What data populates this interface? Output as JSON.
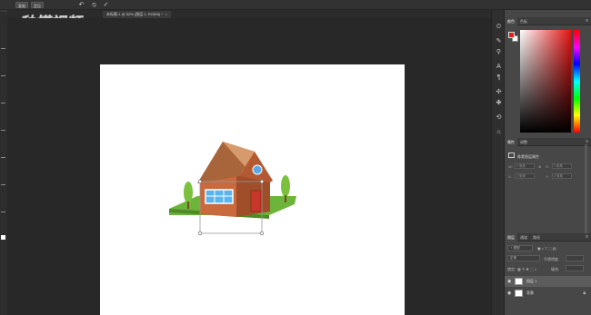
{
  "options_bar": {
    "buttons": [
      "复制",
      "定位"
    ],
    "flip_label": "↶",
    "cancel_label": "⦸",
    "commit_label": "✓"
  },
  "watermark": {
    "text": "秒懂视频"
  },
  "document": {
    "tab_title": "未标题-1 @ 50% (图层 1, RGB/8) *",
    "close": "×"
  },
  "panels": {
    "color": {
      "tabs": [
        "颜色",
        "色板"
      ],
      "foreground": "#e41d1d",
      "background": "#ffffff"
    },
    "properties": {
      "tabs": [
        "属性",
        "调整"
      ],
      "title": "像素图层属性",
      "w_label": "W:",
      "h_label": "H:",
      "x_label": "X:",
      "y_label": "Y:",
      "w_value": "0 像素",
      "h_value": "0 像素",
      "x_value": "0 像素",
      "y_value": "0 像素"
    },
    "layers": {
      "tabs": [
        "图层",
        "通道",
        "路径"
      ],
      "kind_filter": "♀ 类型",
      "blend_mode": "正常",
      "opacity_label": "不透明度:",
      "lock_label": "锁定:",
      "fill_label": "填充:",
      "items": [
        {
          "name": "图层 1",
          "selected": true
        },
        {
          "name": "背景",
          "selected": false
        }
      ]
    }
  },
  "colors": {
    "accent": "#e41d1d",
    "workspace": "#282828"
  }
}
